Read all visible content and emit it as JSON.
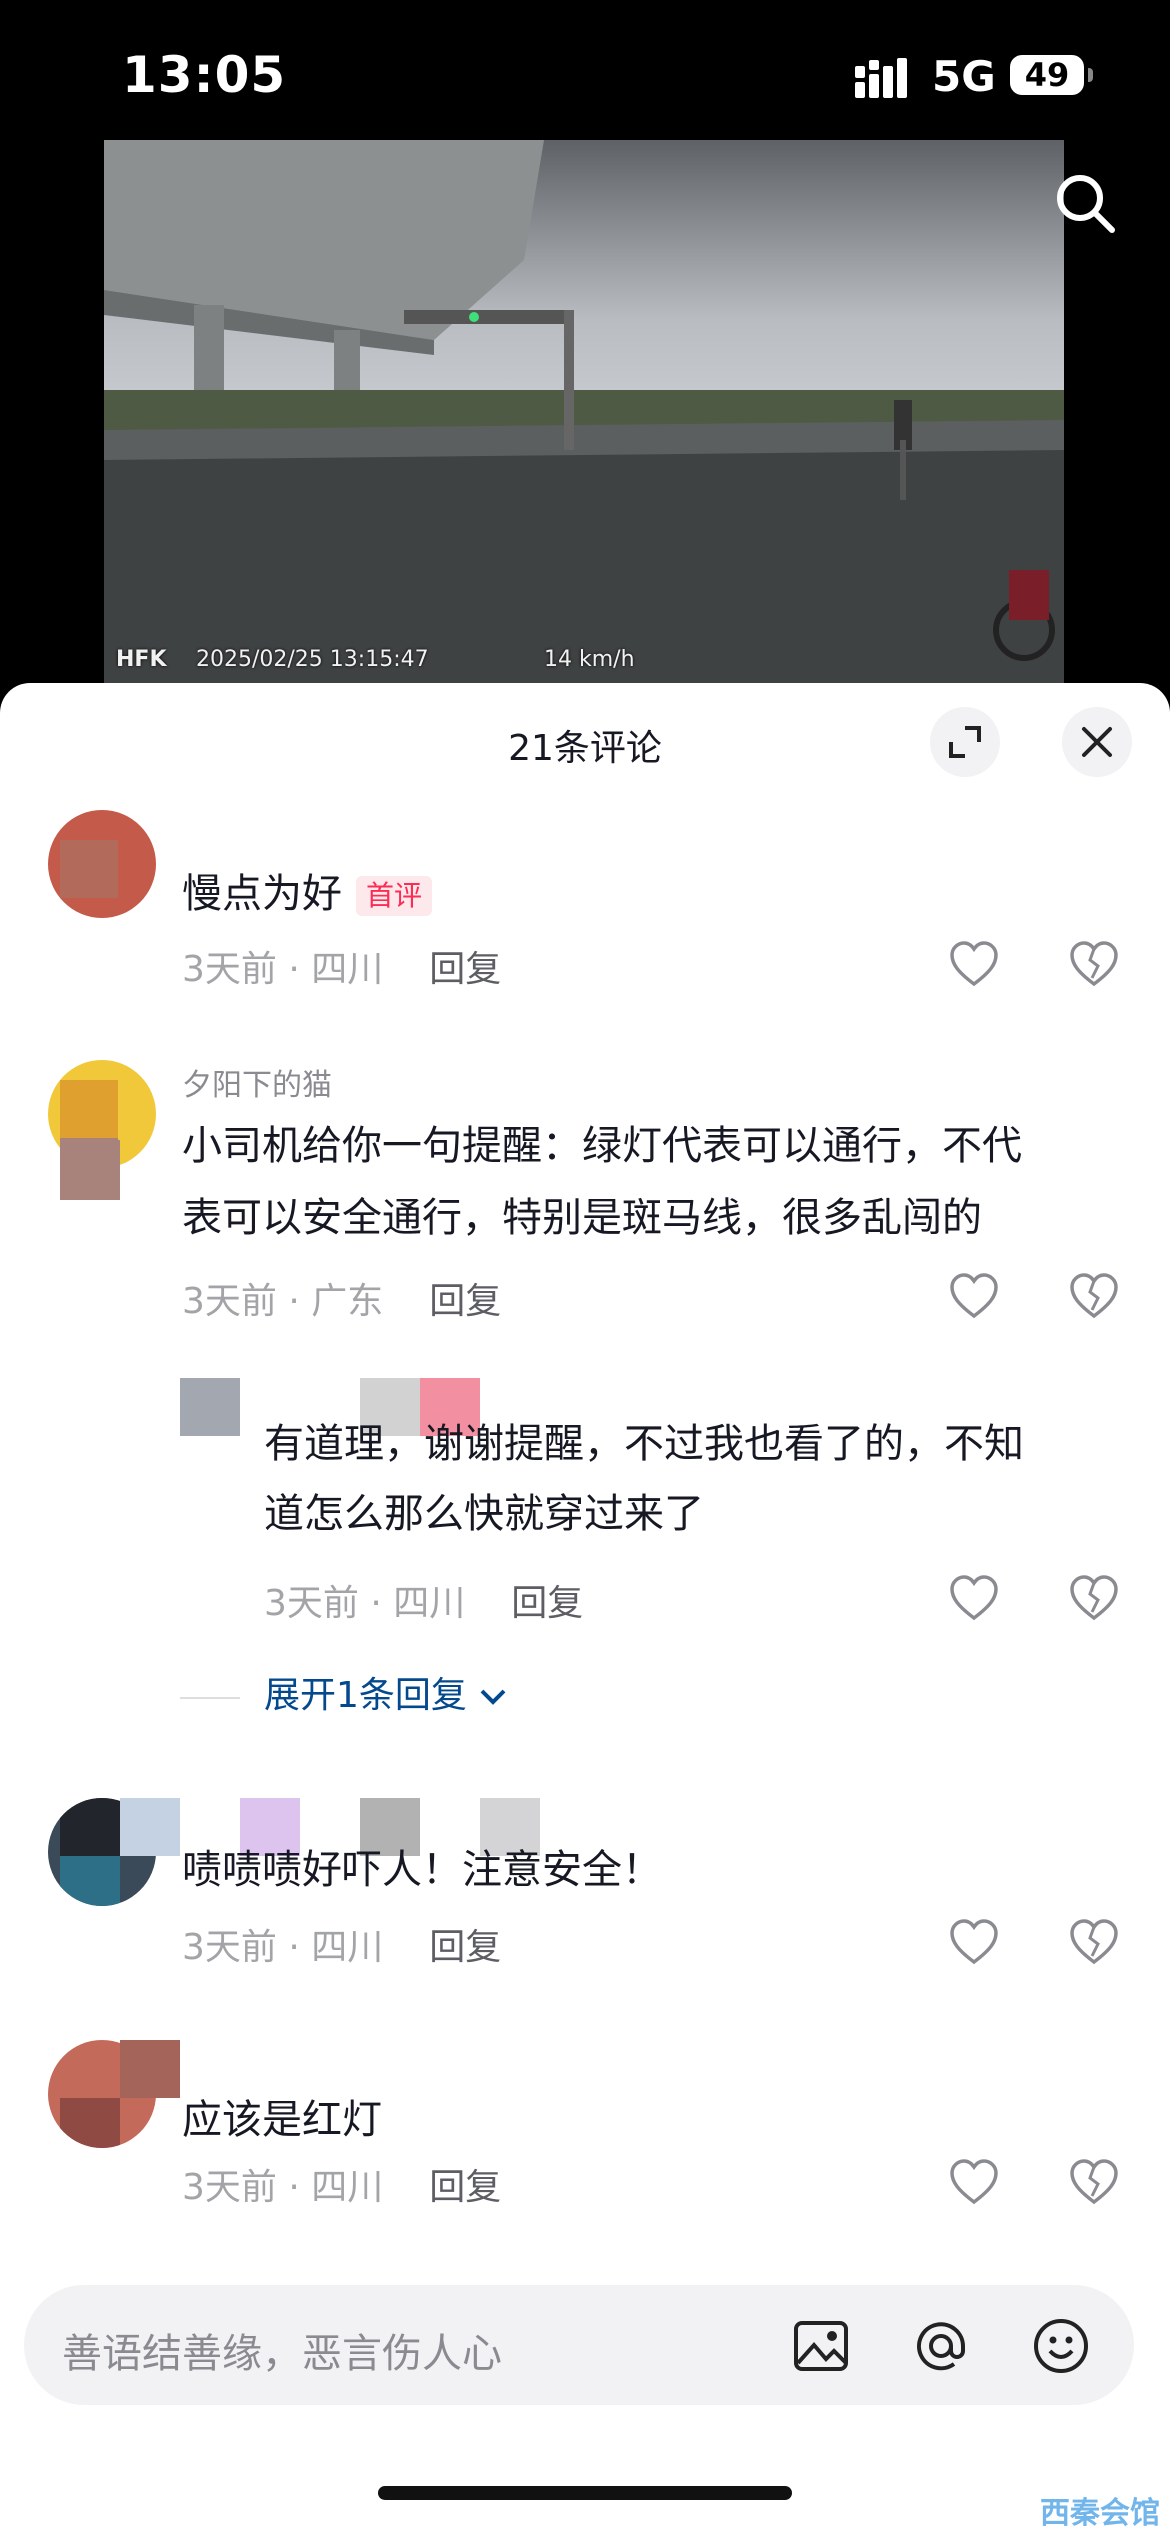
{
  "status_bar": {
    "time": "13:05",
    "network": "5G",
    "battery": "49"
  },
  "video": {
    "brand": "HFK",
    "timestamp": "2025/02/25 13:15:47",
    "speed": "14 km/h"
  },
  "comments_header": {
    "title": "21条评论"
  },
  "comments": [
    {
      "username": "",
      "text": "慢点为好",
      "badge": "首评",
      "meta": "3天前 · 四川",
      "reply": "回复"
    },
    {
      "username": "夕阳下的猫",
      "text_line1": "小司机给你一句提醒：绿灯代表可以通行，不代",
      "text_line2": "表可以安全通行，特别是斑马线，很多乱闯的",
      "meta": "3天前 · 广东",
      "reply": "回复"
    },
    {
      "username": "",
      "text_line1": "有道理，谢谢提醒，不过我也看了的，不知",
      "text_line2": "道怎么那么快就穿过来了",
      "meta": "3天前 · 四川",
      "reply": "回复"
    },
    {
      "username": "",
      "text": "啧啧啧好吓人！注意安全！",
      "meta": "3天前 · 四川",
      "reply": "回复"
    },
    {
      "username": "",
      "text": "应该是红灯",
      "meta": "3天前 · 四川",
      "reply": "回复"
    }
  ],
  "expand_replies": "展开1条回复",
  "input": {
    "placeholder": "善语结善缘，恶言伤人心"
  },
  "watermark": "西秦会馆",
  "icons": [
    "search-icon",
    "expand-icon",
    "close-icon",
    "heart-icon",
    "broken-heart-icon",
    "image-icon",
    "at-icon",
    "emoji-icon",
    "chevron-down-icon"
  ]
}
